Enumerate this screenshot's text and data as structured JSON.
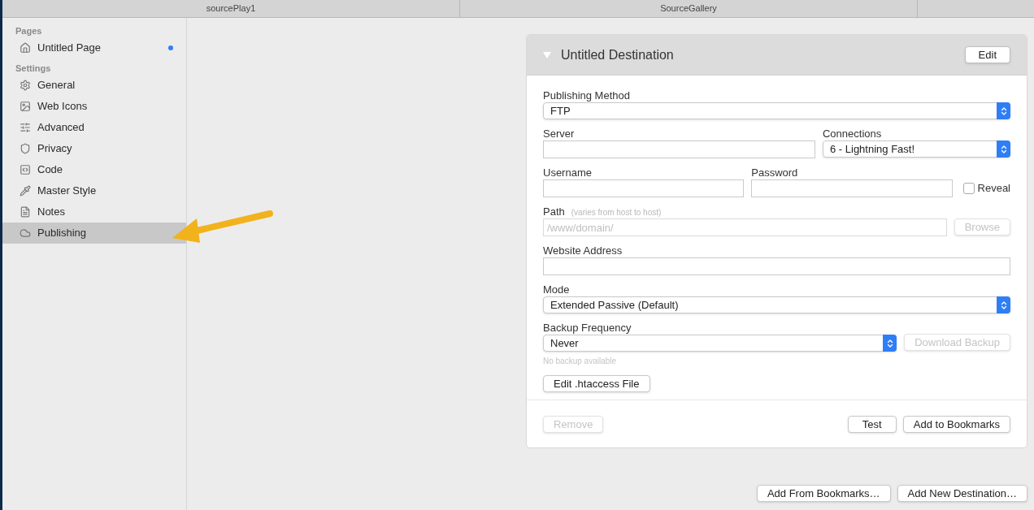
{
  "tabs": [
    {
      "label": "sourcePlay1",
      "selected": false
    },
    {
      "label": "SourceGallery",
      "selected": false
    }
  ],
  "sidebar": {
    "sections": [
      {
        "title": "Pages",
        "items": [
          {
            "label": "Untitled Page",
            "selected": false,
            "modified": true
          }
        ]
      },
      {
        "title": "Settings",
        "items": [
          {
            "label": "General",
            "selected": false,
            "modified": false
          },
          {
            "label": "Web Icons",
            "selected": false,
            "modified": false
          },
          {
            "label": "Advanced",
            "selected": false,
            "modified": false
          },
          {
            "label": "Privacy",
            "selected": false,
            "modified": false
          },
          {
            "label": "Code",
            "selected": false,
            "modified": false
          },
          {
            "label": "Master Style",
            "selected": false,
            "modified": false
          },
          {
            "label": "Notes",
            "selected": false,
            "modified": false
          },
          {
            "label": "Publishing",
            "selected": true,
            "modified": false
          }
        ]
      }
    ]
  },
  "destination": {
    "title": "Untitled Destination",
    "expanded": true,
    "edit_button": "Edit",
    "rows": [
      [
        {
          "kind": "select",
          "label": "Publishing Method",
          "value": "FTP"
        }
      ],
      [
        {
          "kind": "field",
          "label": "Server"
        },
        {
          "kind": "select",
          "label": "Connections",
          "value": "6 - Lightning Fast!"
        }
      ],
      [
        {
          "kind": "field",
          "label": "Username"
        },
        {
          "kind": "field",
          "label": "Password"
        },
        {
          "kind": "checkbox",
          "label": "Reveal",
          "checked": false
        }
      ],
      [
        {
          "kind": "field",
          "label": "Path",
          "hint": "(varies from host to host)",
          "placeholder": "/www/domain/",
          "disabled": true
        },
        {
          "kind": "button",
          "label": "Browse",
          "disabled": true
        }
      ],
      [
        {
          "kind": "field",
          "label": "Website Address"
        }
      ],
      [
        {
          "kind": "select",
          "label": "Mode",
          "value": "Extended Passive (Default)"
        }
      ],
      [
        {
          "kind": "select",
          "label": "Backup Frequency",
          "value": "Never"
        },
        {
          "kind": "button",
          "label": "Download Backup",
          "disabled": true
        }
      ],
      [
        {
          "kind": "note",
          "label": "No backup available"
        }
      ],
      [
        {
          "kind": "button",
          "label": "Edit .htaccess File",
          "disabled": false
        }
      ]
    ],
    "footer_left": [
      {
        "label": "Remove",
        "disabled": true
      }
    ],
    "footer_right": [
      {
        "label": "Test",
        "disabled": false
      },
      {
        "label": "Add to Bookmarks",
        "disabled": false
      }
    ]
  },
  "bottom_buttons": [
    {
      "label": "Add From Bookmarks…",
      "disabled": false
    },
    {
      "label": "Add New Destination…",
      "disabled": false
    }
  ]
}
